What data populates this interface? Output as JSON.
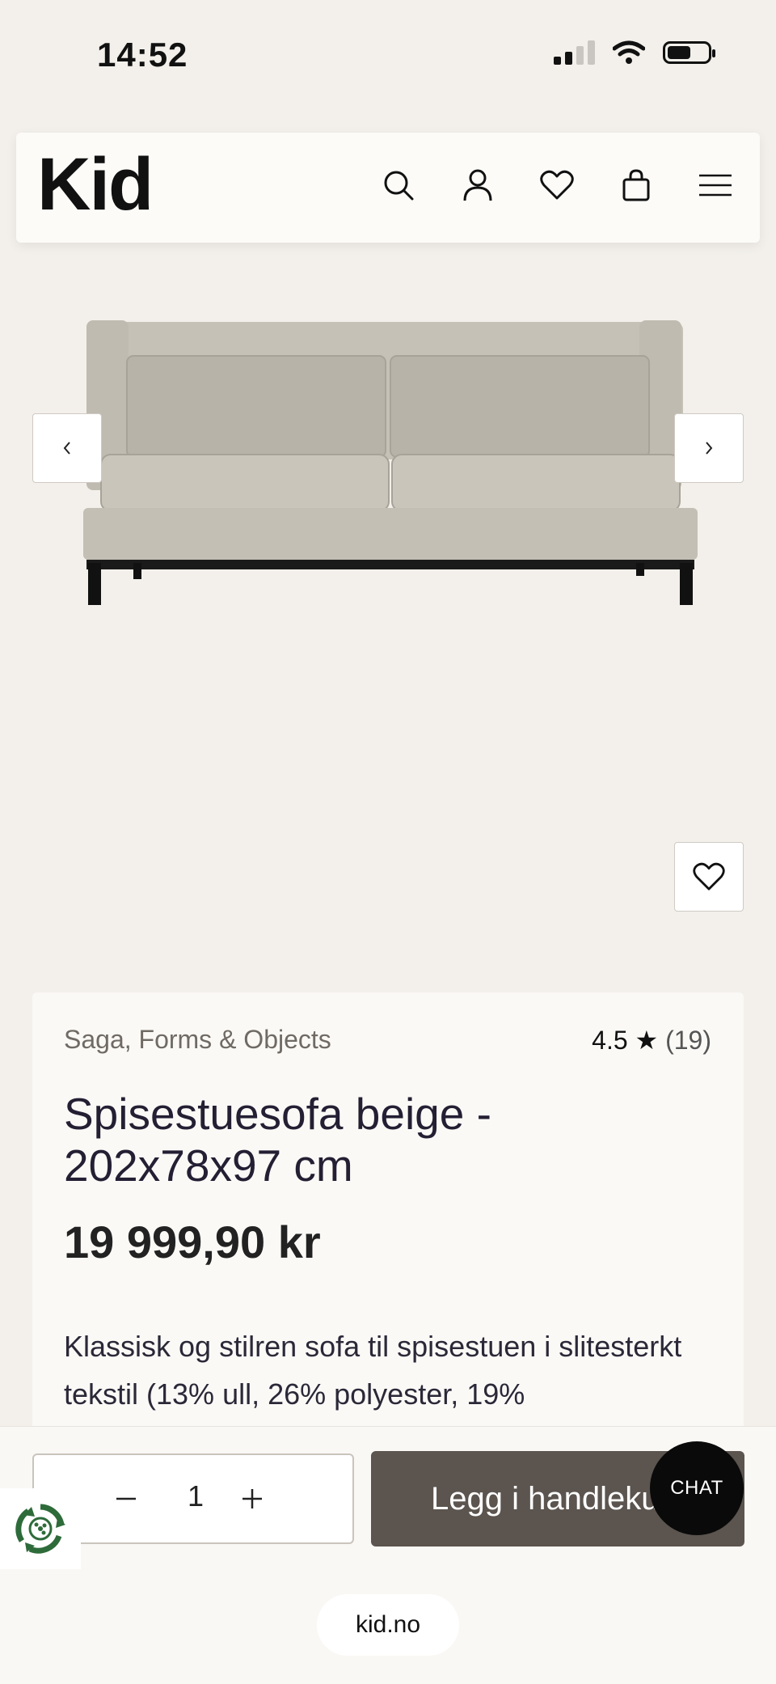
{
  "status_bar": {
    "time": "14:52",
    "icons": [
      "signal-icon",
      "wifi-icon",
      "battery-icon"
    ]
  },
  "header": {
    "logo": "Kid",
    "icons": [
      "search-icon",
      "account-icon",
      "wishlist-icon",
      "cart-icon",
      "menu-icon"
    ]
  },
  "gallery": {
    "image": "sofa-product-image",
    "prev_icon": "chevron-left-icon",
    "next_icon": "chevron-right-icon",
    "wishlist_icon": "heart-icon"
  },
  "product": {
    "brand": "Saga, Forms & Objects",
    "rating": "4.5",
    "rating_star": "★",
    "review_count": "(19)",
    "title": "Spisestuesofa beige - 202x78x97 cm",
    "price": "19 999,90 kr",
    "description": "Klassisk og stilren sofa til spisestuen i slitesterkt tekstil (13% ull, 26% polyester, 19%"
  },
  "cart_bar": {
    "quantity": "1",
    "add_to_cart_label": "Legg i handlekurv",
    "chat_label": "CHAT"
  },
  "browser": {
    "url": "kid.no"
  },
  "colors": {
    "background": "#f3f0eb",
    "button_dark": "#5b544f",
    "chat": "#0a0a0a",
    "title_text": "#241f33",
    "recycle_green": "#2e6b3a"
  }
}
